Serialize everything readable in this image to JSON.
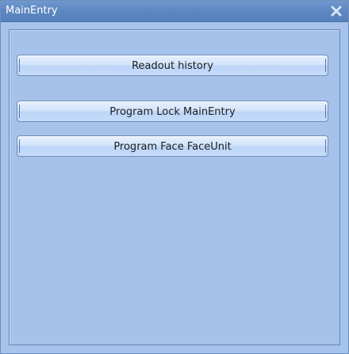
{
  "window": {
    "title": "MainEntry",
    "close_icon": "close-icon"
  },
  "buttons": [
    {
      "label": "Readout history"
    },
    {
      "label": "Program Lock MainEntry"
    },
    {
      "label": "Program Face FaceUnit"
    }
  ],
  "colors": {
    "titlebar": "#5d87c1",
    "window_background": "#a7c3eb",
    "button_top": "#e8f1fd",
    "button_bottom": "#bcd5f7",
    "close_icon": "#d7e4f6"
  }
}
